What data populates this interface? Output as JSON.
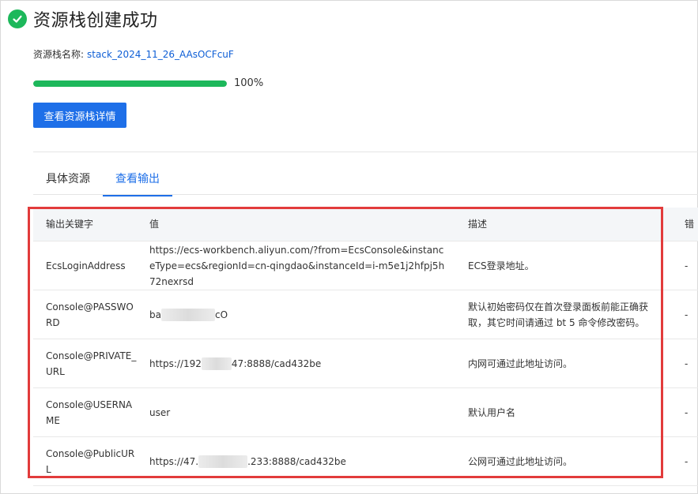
{
  "header": {
    "title": "资源栈创建成功",
    "status_icon": "check-circle-icon",
    "status_color": "#1db85b"
  },
  "stack": {
    "name_label": "资源栈名称:",
    "name_value": "stack_2024_11_26_AAsOCFcuF"
  },
  "progress": {
    "value": 1.0,
    "label": "100%"
  },
  "actions": {
    "detail_button": "查看资源栈详情"
  },
  "tabs": [
    {
      "label": "具体资源",
      "active": false
    },
    {
      "label": "查看输出",
      "active": true
    }
  ],
  "table": {
    "headers": [
      "输出关键字",
      "值",
      "描述",
      "错"
    ],
    "rows": [
      {
        "key": "EcsLoginAddress",
        "value_pre": "https://ecs-workbench.aliyun.com/?from=EcsConsole&instanceType=ecs&regionId=cn-qingdao&instanceId=i-m5e1j2hfpj5h72nexrsd",
        "value_post": "",
        "desc": "ECS登录地址。",
        "error": "-"
      },
      {
        "key": "Console@PASSWORD",
        "value_pre": "ba",
        "value_post": "cO",
        "desc": "默认初始密码仅在首次登录面板前能正确获取，其它时间请通过 bt 5 命令修改密码。",
        "error": "-"
      },
      {
        "key": "Console@PRIVATE_URL",
        "value_pre": "https://192",
        "value_post": "47:8888/cad432be",
        "desc": "内网可通过此地址访问。",
        "error": "-"
      },
      {
        "key": "Console@USERNAME",
        "value_pre": "user",
        "value_post": "",
        "desc": "默认用户名",
        "error": "-"
      },
      {
        "key": "Console@PublicURL",
        "value_pre": "https://47.",
        "value_post": ".233:8888/cad432be",
        "desc": "公网可通过此地址访问。",
        "error": "-"
      }
    ]
  },
  "colors": {
    "accent": "#1e6fe8",
    "highlight": "#e23b3b",
    "link": "#0f5fd6"
  }
}
